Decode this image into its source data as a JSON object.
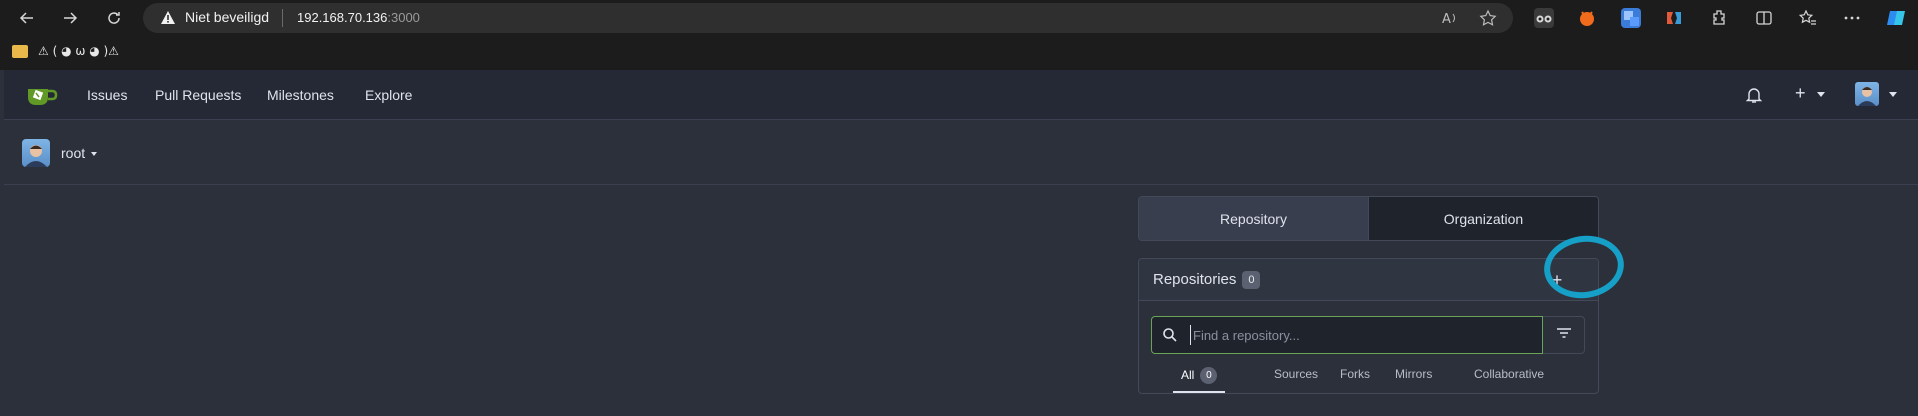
{
  "browser": {
    "security_label": "Niet beveiligd",
    "url_host": "192.168.70.136",
    "url_port": ":3000",
    "bookmark_label": "⚠ ( ◕ ω ◕ )⚠"
  },
  "nav": {
    "links": [
      "Issues",
      "Pull Requests",
      "Milestones",
      "Explore"
    ],
    "add_symbol": "+"
  },
  "context": {
    "user": "root"
  },
  "switch": {
    "repository": "Repository",
    "organization": "Organization"
  },
  "repos": {
    "title": "Repositories",
    "count": "0",
    "add_symbol": "+",
    "search_placeholder": "Find a repository...",
    "tabs": {
      "all": "All",
      "all_count": "0",
      "sources": "Sources",
      "forks": "Forks",
      "mirrors": "Mirrors",
      "collaborative": "Collaborative"
    }
  },
  "colors": {
    "annotation_circle": "#16a0c8",
    "gitea_green": "#609926",
    "search_focus": "#6aa457"
  }
}
